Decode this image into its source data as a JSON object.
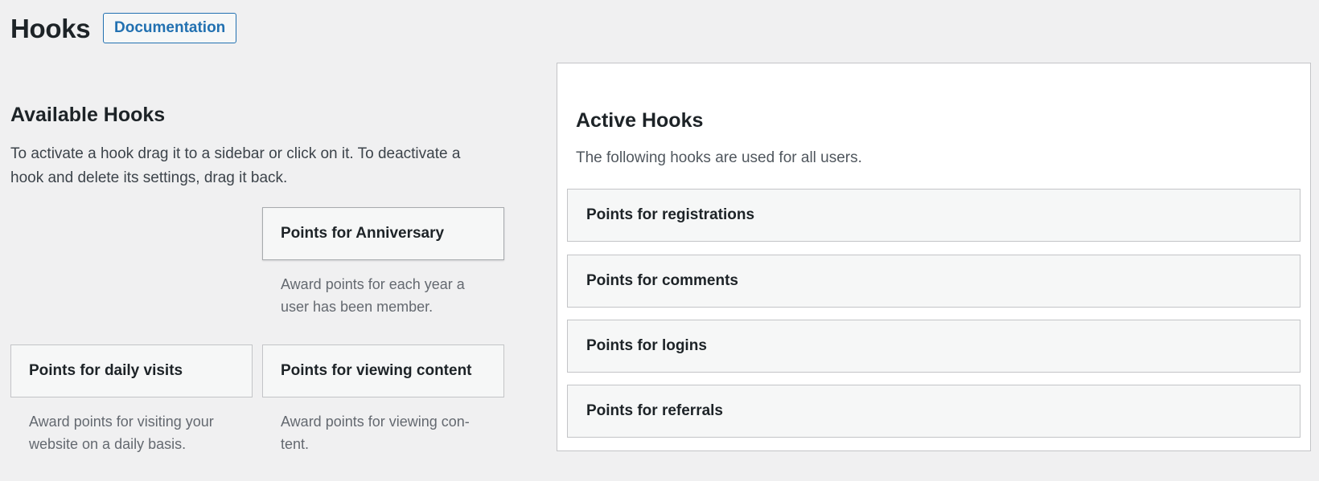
{
  "header": {
    "title": "Hooks",
    "documentation_button": "Documentation"
  },
  "available": {
    "title": "Available Hooks",
    "description": "To activate a hook drag it to a sidebar or click on it. To deactivate a hook and delete its settings, drag it back.",
    "hooks": [
      {
        "label": "Points for Anniversary",
        "description": "Award points for each year a user has been member."
      },
      {
        "label": "Points for daily visits",
        "description": "Award points for visiting your website on a daily basis."
      },
      {
        "label": "Points for viewing content",
        "description": "Award points for viewing con-tent."
      }
    ]
  },
  "active": {
    "title": "Active Hooks",
    "description": "The following hooks are used for all users.",
    "hooks": [
      {
        "label": "Points for registrations"
      },
      {
        "label": "Points for comments"
      },
      {
        "label": "Points for logins"
      },
      {
        "label": "Points for referrals"
      }
    ]
  }
}
